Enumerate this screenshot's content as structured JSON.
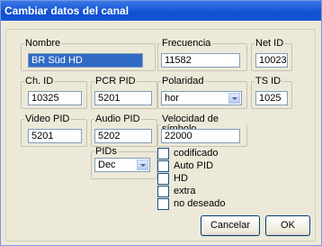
{
  "window": {
    "title": "Cambiar datos del canal"
  },
  "fields": {
    "nombre": {
      "label": "Nombre",
      "value": "BR Süd HD"
    },
    "frecuencia": {
      "label": "Frecuencia",
      "value": "11582"
    },
    "net_id": {
      "label": "Net ID",
      "value": "10023"
    },
    "ch_id": {
      "label": "Ch. ID",
      "value": "10325"
    },
    "pcr_pid": {
      "label": "PCR PID",
      "value": "5201"
    },
    "polaridad": {
      "label": "Polaridad",
      "value": "hor"
    },
    "ts_id": {
      "label": "TS ID",
      "value": "1025"
    },
    "video_pid": {
      "label": "Video PID",
      "value": "5201"
    },
    "audio_pid": {
      "label": "Audio PID",
      "value": "5202"
    },
    "velocidad": {
      "label": "Velocidad de símbolo",
      "value": "22000"
    },
    "pids": {
      "label": "PIDs",
      "value": "Dec"
    }
  },
  "checkboxes": [
    {
      "label": "codificado",
      "checked": false
    },
    {
      "label": "Auto PID",
      "checked": false
    },
    {
      "label": "HD",
      "checked": false
    },
    {
      "label": "extra",
      "checked": false
    },
    {
      "label": "no deseado",
      "checked": false
    }
  ],
  "buttons": {
    "cancel": "Cancelar",
    "ok": "OK"
  }
}
